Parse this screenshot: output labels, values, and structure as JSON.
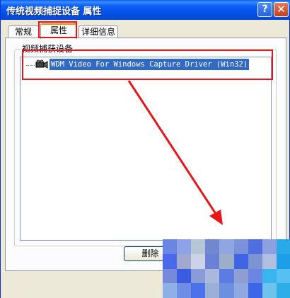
{
  "window": {
    "title": "传统视频捕捉设备 属性",
    "help_label": "?",
    "close_label": "✕"
  },
  "tabs": [
    {
      "label": "常规"
    },
    {
      "label": "属性"
    },
    {
      "label": "详细信息"
    }
  ],
  "group": {
    "label": "视频捕获设备",
    "device": "WDM Video For Windows Capture Driver (Win32)",
    "device_icon": "camera-icon"
  },
  "footer": {
    "delete_label": "删除"
  },
  "annotation": {
    "color": "#e8161b"
  },
  "mosaic": {
    "colors": [
      "#6b86e0",
      "#8ea2e8",
      "#b7c6d6",
      "#6f88cf",
      "#90a6e2",
      "#7a92da",
      "#4f6ee0",
      "#8fa0e0",
      "#2aa9e8",
      "#4a69ea",
      "#a0a8d0",
      "#cbd3e8",
      "#6d80d8",
      "#9bb0c8",
      "#3f64e6",
      "#7d94d4",
      "#b0bee0",
      "#1e9ee6",
      "#7589d8",
      "#3c5ce0",
      "#8a9cd8",
      "#aab8de",
      "#5c7ce4",
      "#8f9ed0",
      "#6a86e2",
      "#38b4ee",
      "#54bff0",
      "#8fb0e4",
      "#6e8ee6",
      "#4a70ea",
      "#9ab0d8",
      "#6d8fe0",
      "#8fa8e0",
      "#3a66e8",
      "#6fc2ec",
      "#2eaee8"
    ]
  }
}
